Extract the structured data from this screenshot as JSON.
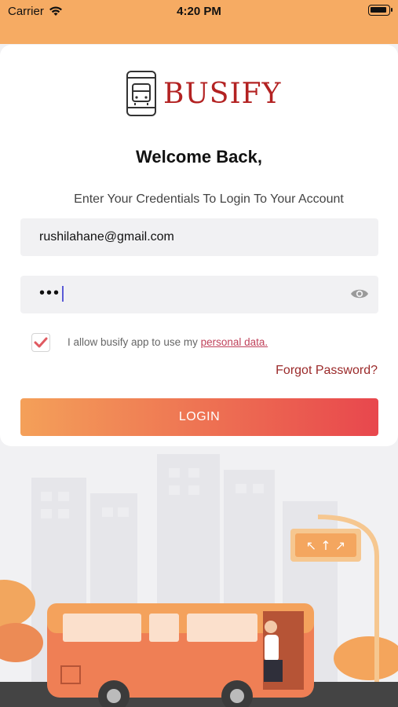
{
  "status": {
    "carrier": "Carrier",
    "time": "4:20 PM"
  },
  "brand": {
    "name": "BUSIFY",
    "color": "#b32222"
  },
  "welcome": "Welcome Back,",
  "subtitle": "Enter Your Credentials To Login To Your Account",
  "email": {
    "value": "rushilahane@gmail.com"
  },
  "password": {
    "masked": "•••",
    "visibility_icon": "eye-icon"
  },
  "consent": {
    "checked": true,
    "text": "I allow busify app to use my ",
    "link": "personal data."
  },
  "forgot_password": "Forgot Password?",
  "login_button": "LOGIN",
  "colors": {
    "accent_start": "#f4a059",
    "accent_end": "#e8474d",
    "header": "#f6ab63"
  }
}
